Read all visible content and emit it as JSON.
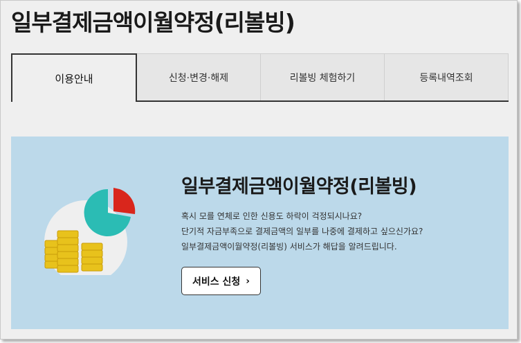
{
  "page": {
    "title": "일부결제금액이월약정(리볼빙)"
  },
  "tabs": [
    {
      "label": "이용안내",
      "active": true
    },
    {
      "label": "신청·변경·해제",
      "active": false
    },
    {
      "label": "리볼빙 체험하기",
      "active": false
    },
    {
      "label": "등록내역조회",
      "active": false
    }
  ],
  "banner": {
    "title": "일부결제금액이월약정(리볼빙)",
    "lines": [
      "혹시 모를 연체로 인한 신용도 하락이 걱정되시나요?",
      "단기적 자금부족으로 결제금액의 일부를 나중에 결제하고 싶으신가요?",
      "일부결제금액이월약정(리볼빙) 서비스가 해답을 알려드립니다."
    ],
    "button_label": "서비스 신청",
    "button_icon": "chevron-right-icon"
  },
  "colors": {
    "banner_bg": "#bcd9ea",
    "pie_main": "#2bbcb4",
    "pie_slice": "#d9261c",
    "coin": "#e8c21c"
  }
}
